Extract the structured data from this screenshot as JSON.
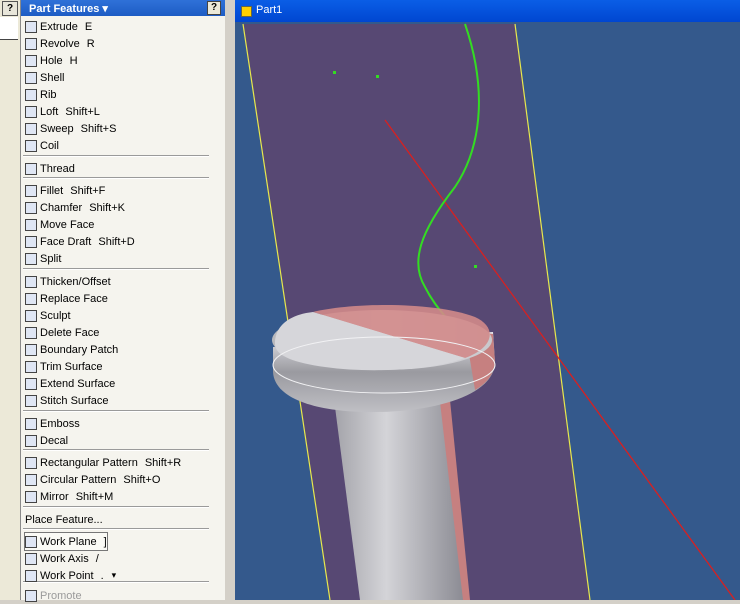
{
  "panel": {
    "title": "Part Features",
    "help": "?"
  },
  "left_help": "?",
  "viewport": {
    "title": "Part1"
  },
  "commands": [
    {
      "label": "Extrude",
      "shortcut": "E",
      "icon": "extrude-icon"
    },
    {
      "label": "Revolve",
      "shortcut": "R",
      "icon": "revolve-icon"
    },
    {
      "label": "Hole",
      "shortcut": "H",
      "icon": "hole-icon"
    },
    {
      "label": "Shell",
      "shortcut": "",
      "icon": "shell-icon"
    },
    {
      "label": "Rib",
      "shortcut": "",
      "icon": "rib-icon"
    },
    {
      "label": "Loft",
      "shortcut": "Shift+L",
      "icon": "loft-icon"
    },
    {
      "label": "Sweep",
      "shortcut": "Shift+S",
      "icon": "sweep-icon"
    },
    {
      "label": "Coil",
      "shortcut": "",
      "icon": "coil-icon"
    },
    {
      "label": "Thread",
      "shortcut": "",
      "icon": "thread-icon"
    },
    {
      "label": "Fillet",
      "shortcut": "Shift+F",
      "icon": "fillet-icon"
    },
    {
      "label": "Chamfer",
      "shortcut": "Shift+K",
      "icon": "chamfer-icon"
    },
    {
      "label": "Move Face",
      "shortcut": "",
      "icon": "move-face-icon"
    },
    {
      "label": "Face Draft",
      "shortcut": "Shift+D",
      "icon": "face-draft-icon"
    },
    {
      "label": "Split",
      "shortcut": "",
      "icon": "split-icon"
    },
    {
      "label": "Thicken/Offset",
      "shortcut": "",
      "icon": "thicken-icon"
    },
    {
      "label": "Replace Face",
      "shortcut": "",
      "icon": "replace-face-icon"
    },
    {
      "label": "Sculpt",
      "shortcut": "",
      "icon": "sculpt-icon"
    },
    {
      "label": "Delete Face",
      "shortcut": "",
      "icon": "delete-face-icon"
    },
    {
      "label": "Boundary Patch",
      "shortcut": "",
      "icon": "boundary-patch-icon"
    },
    {
      "label": "Trim Surface",
      "shortcut": "",
      "icon": "trim-surface-icon"
    },
    {
      "label": "Extend Surface",
      "shortcut": "",
      "icon": "extend-surface-icon"
    },
    {
      "label": "Stitch Surface",
      "shortcut": "",
      "icon": "stitch-surface-icon"
    },
    {
      "label": "Emboss",
      "shortcut": "",
      "icon": "emboss-icon"
    },
    {
      "label": "Decal",
      "shortcut": "",
      "icon": "decal-icon"
    },
    {
      "label": "Rectangular Pattern",
      "shortcut": "Shift+R",
      "icon": "rect-pattern-icon"
    },
    {
      "label": "Circular Pattern",
      "shortcut": "Shift+O",
      "icon": "circ-pattern-icon"
    },
    {
      "label": "Mirror",
      "shortcut": "Shift+M",
      "icon": "mirror-icon"
    },
    {
      "label": "Place Feature...",
      "shortcut": "",
      "icon": ""
    },
    {
      "label": "Work Plane",
      "shortcut": "]",
      "icon": "work-plane-icon"
    },
    {
      "label": "Work Axis",
      "shortcut": "/",
      "icon": "work-axis-icon"
    },
    {
      "label": "Work Point",
      "shortcut": ".",
      "icon": "work-point-icon"
    },
    {
      "label": "Promote",
      "shortcut": "",
      "icon": "promote-icon"
    }
  ],
  "colors": {
    "background": "#34598c",
    "plane": "#574873",
    "plane_edge": "#e8e84c",
    "curve": "#33dd22",
    "axis": "#d82020",
    "part": "#c8c8cc"
  }
}
